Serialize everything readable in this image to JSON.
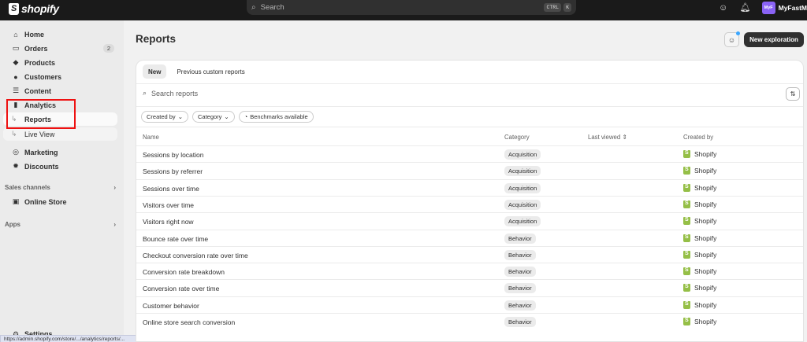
{
  "topbar": {
    "brand": "shopify",
    "search_placeholder": "Search",
    "shortcut_keys": [
      "CTRL",
      "K"
    ],
    "store_avatar": "MyF",
    "store_name": "MyFastM"
  },
  "sidebar": {
    "items": [
      {
        "label": "Home",
        "icon": "home-icon"
      },
      {
        "label": "Orders",
        "icon": "inbox-icon",
        "badge": "2"
      },
      {
        "label": "Products",
        "icon": "tag-icon"
      },
      {
        "label": "Customers",
        "icon": "person-icon"
      },
      {
        "label": "Content",
        "icon": "content-icon"
      },
      {
        "label": "Analytics",
        "icon": "bar-chart-icon"
      },
      {
        "label": "Reports",
        "icon": "subnav-arrow-icon"
      },
      {
        "label": "Live View",
        "icon": "subnav-arrow-icon"
      },
      {
        "label": "Marketing",
        "icon": "target-icon"
      },
      {
        "label": "Discounts",
        "icon": "discount-icon"
      }
    ],
    "sales_channels_label": "Sales channels",
    "online_store_label": "Online Store",
    "apps_label": "Apps",
    "settings_label": "Settings",
    "status_url": "https://admin.shopify.com/store/.../analytics/reports/..."
  },
  "main": {
    "title": "Reports",
    "new_exploration_label": "New exploration",
    "tabs": [
      {
        "label": "New"
      },
      {
        "label": "Previous custom reports"
      }
    ],
    "search_placeholder": "Search reports",
    "filters": {
      "created_by": "Created by",
      "category": "Category",
      "benchmarks": "Benchmarks available"
    },
    "columns": {
      "name": "Name",
      "category": "Category",
      "last_viewed": "Last viewed",
      "created_by": "Created by"
    },
    "rows": [
      {
        "name": "Sessions by location",
        "category": "Acquisition",
        "created_by": "Shopify"
      },
      {
        "name": "Sessions by referrer",
        "category": "Acquisition",
        "created_by": "Shopify"
      },
      {
        "name": "Sessions over time",
        "category": "Acquisition",
        "created_by": "Shopify"
      },
      {
        "name": "Visitors over time",
        "category": "Acquisition",
        "created_by": "Shopify"
      },
      {
        "name": "Visitors right now",
        "category": "Acquisition",
        "created_by": "Shopify"
      },
      {
        "name": "Bounce rate over time",
        "category": "Behavior",
        "created_by": "Shopify"
      },
      {
        "name": "Checkout conversion rate over time",
        "category": "Behavior",
        "created_by": "Shopify"
      },
      {
        "name": "Conversion rate breakdown",
        "category": "Behavior",
        "created_by": "Shopify"
      },
      {
        "name": "Conversion rate over time",
        "category": "Behavior",
        "created_by": "Shopify"
      },
      {
        "name": "Customer behavior",
        "category": "Behavior",
        "created_by": "Shopify"
      },
      {
        "name": "Online store search conversion",
        "category": "Behavior",
        "created_by": "Shopify"
      }
    ]
  },
  "colors": {
    "topbar": "#1a1a1a",
    "shopify_green": "#95bf47",
    "highlight_box": "#ee1111",
    "primary_button": "#303030"
  }
}
